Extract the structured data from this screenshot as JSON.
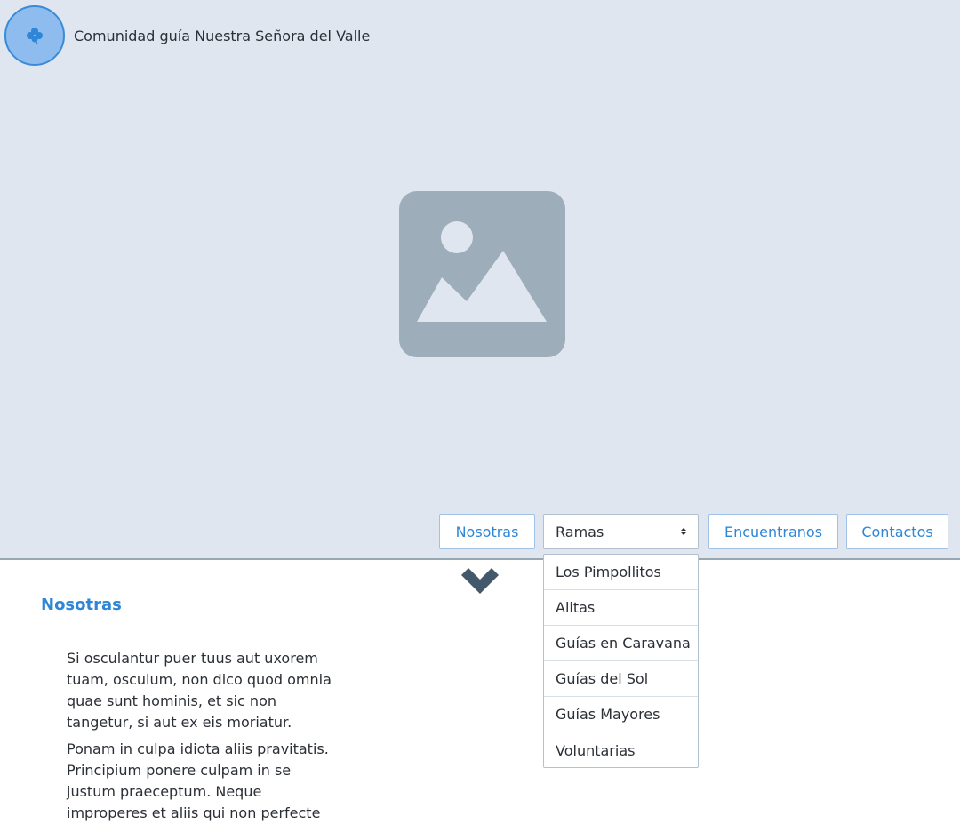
{
  "header": {
    "site_title": "Comunidad guía Nuestra Señora del Valle",
    "logo_icon": "clover-icon",
    "hero_icon": "image-placeholder-icon"
  },
  "nav": {
    "nosotras": "Nosotras",
    "ramas_selected": "Ramas",
    "ramas_options": [
      "Los Pimpollitos",
      "Alitas",
      "Guías en Caravana",
      "Guías del Sol",
      "Guías Mayores",
      "Voluntarias"
    ],
    "encuentranos": "Encuentranos",
    "contactos": "Contactos"
  },
  "section": {
    "title": "Nosotras",
    "paragraphs": [
      "Si osculantur puer tuus aut uxorem tuam, osculum, non dico quod omnia quae sunt hominis, et sic non tangetur, si aut ex eis moriatur.",
      "Ponam in culpa idiota aliis pravitatis. Principium ponere culpam in se justum praeceptum. Neque improperes et aliis qui non perfecte"
    ]
  },
  "colors": {
    "hero_bg": "#dfe6ef",
    "accent": "#2f86d6",
    "logo_fill": "#8fbcee",
    "placeholder": "#9eadba"
  }
}
